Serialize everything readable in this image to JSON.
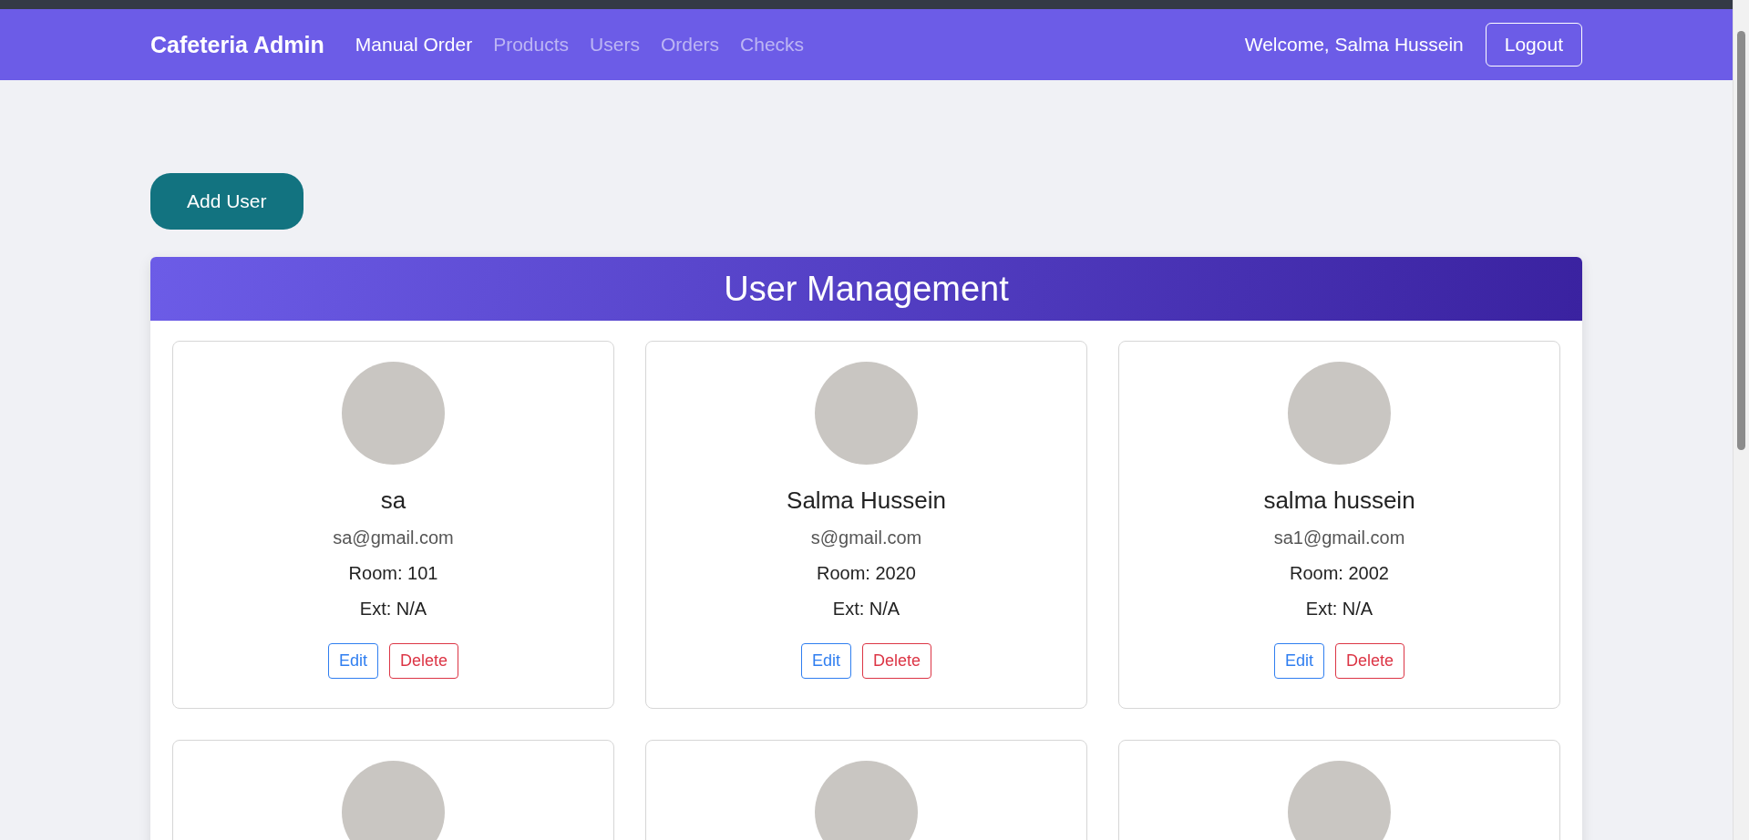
{
  "navbar": {
    "brand": "Cafeteria Admin",
    "links": [
      {
        "label": "Manual Order",
        "selected": true
      },
      {
        "label": "Products",
        "selected": false
      },
      {
        "label": "Users",
        "selected": false
      },
      {
        "label": "Orders",
        "selected": false
      },
      {
        "label": "Checks",
        "selected": false
      }
    ],
    "welcome": "Welcome, Salma Hussein",
    "logout": "Logout"
  },
  "add_button": "Add User",
  "panel": {
    "title": "User Management",
    "cards": [
      {
        "kind": "user",
        "name": "sa",
        "email": "sa@gmail.com",
        "room": "Room: 101",
        "ext": "Ext: N/A",
        "edit": "Edit",
        "delete": "Delete"
      },
      {
        "kind": "user",
        "name": "Salma Hussein",
        "email": "s@gmail.com",
        "room": "Room: 2020",
        "ext": "Ext: N/A",
        "edit": "Edit",
        "delete": "Delete"
      },
      {
        "kind": "user",
        "name": "salma hussein",
        "email": "sa1@gmail.com",
        "room": "Room: 2002",
        "ext": "Ext: N/A",
        "edit": "Edit",
        "delete": "Delete"
      },
      {
        "kind": "cut-off"
      },
      {
        "kind": "cut-off"
      },
      {
        "kind": "cut-off"
      }
    ]
  }
}
